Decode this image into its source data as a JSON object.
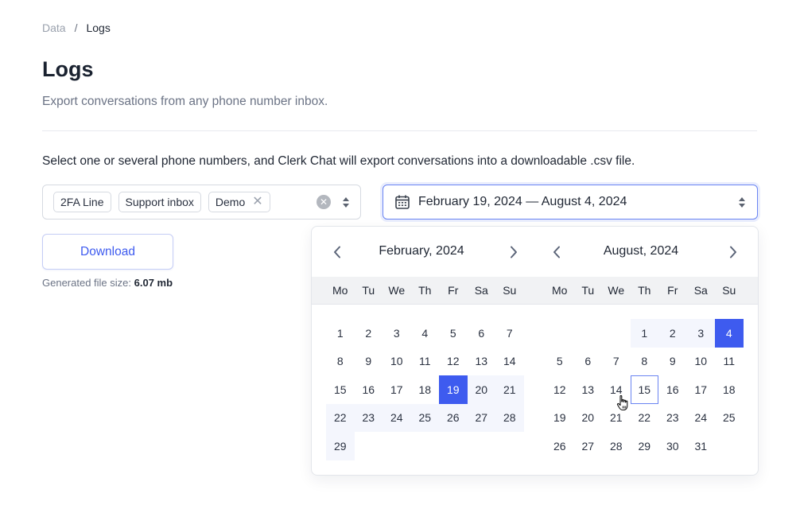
{
  "breadcrumb": {
    "parent": "Data",
    "separator": "/",
    "current": "Logs"
  },
  "page": {
    "title": "Logs",
    "subtitle": "Export conversations from any phone number inbox.",
    "instructions": "Select one or several phone numbers, and Clerk Chat will export conversations into a downloadable .csv file."
  },
  "phone_select": {
    "chips": [
      {
        "label": "2FA Line",
        "removable": false
      },
      {
        "label": "Support inbox",
        "removable": false
      },
      {
        "label": "Demo",
        "removable": true
      }
    ],
    "clear_icon": "circle-x-icon",
    "chevron_icon": "up-down-arrows-icon"
  },
  "download": {
    "button_label": "Download",
    "file_size_label": "Generated file size:",
    "file_size_value": "6.07 mb"
  },
  "date_range": {
    "value": "February 19, 2024 — August 4, 2024",
    "icon": "calendar-icon",
    "start": "2024-02-19",
    "end": "2024-08-04",
    "hovered": "2024-08-15"
  },
  "calendar": {
    "weekdays": [
      "Mo",
      "Tu",
      "We",
      "Th",
      "Fr",
      "Sa",
      "Su"
    ],
    "months": [
      {
        "title": "February, 2024",
        "offset": 0,
        "days": 29,
        "selected": [
          19
        ],
        "range_from": 19,
        "range_to": 29,
        "hover": null
      },
      {
        "title": "August, 2024",
        "offset": 3,
        "days": 31,
        "selected": [
          4
        ],
        "range_from": 1,
        "range_to": 3,
        "hover": 15
      }
    ]
  },
  "colors": {
    "accent": "#3e5bef",
    "range_bg": "#f4f6fd",
    "header_bg": "#f1f2f4",
    "text": "#1f2633",
    "muted": "#6b7385"
  }
}
